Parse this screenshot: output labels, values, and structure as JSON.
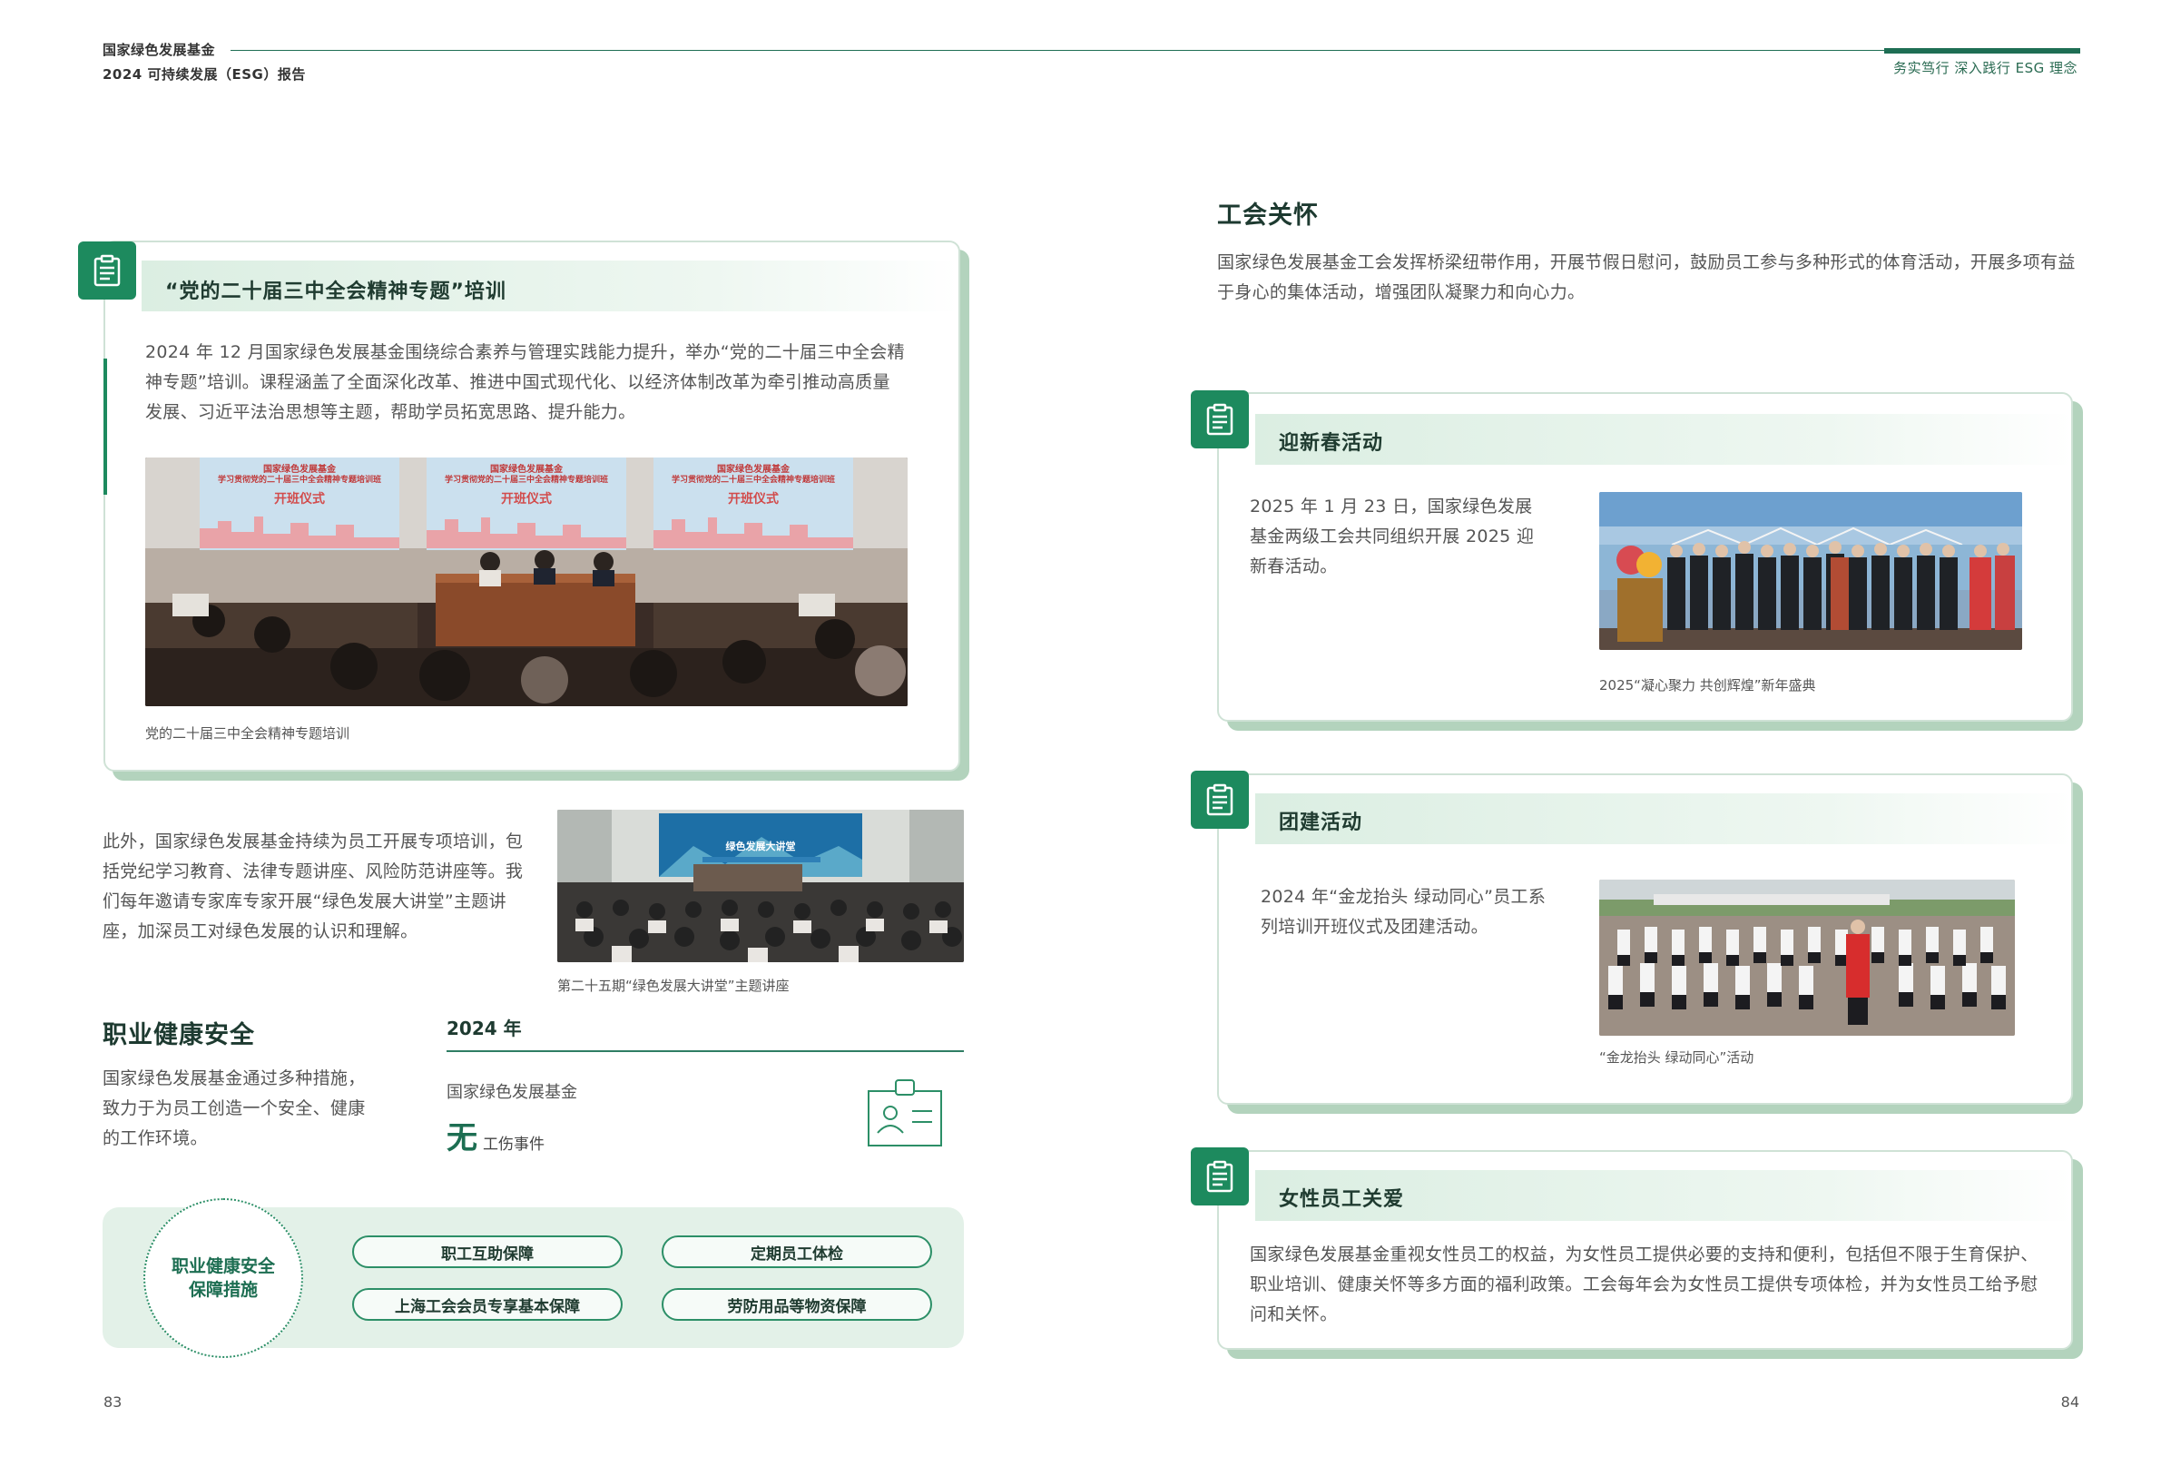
{
  "header": {
    "org": "国家绿色发展基金",
    "report": "2024 可持续发展（ESG）报告",
    "slogan": "务实笃行 深入践行 ESG 理念"
  },
  "pages": {
    "left": "83",
    "right": "84"
  },
  "training_card": {
    "title": "“党的二十届三中全会精神专题”培训",
    "body": "2024 年 12 月国家绿色发展基金围绕综合素养与管理实践能力提升，举办“党的二十届三中全会精神专题”培训。课程涵盖了全面深化改革、推进中国式现代化、以经济体制改革为牵引推动高质量发展、习近平法治思想等主题，帮助学员拓宽思路、提升能力。",
    "banner_org": "国家绿色发展基金",
    "banner_title": "学习贯彻党的二十届三中全会精神专题培训班",
    "banner_sub": "开班仪式",
    "caption": "党的二十届三中全会精神专题培训"
  },
  "special_training": {
    "body": "此外，国家绿色发展基金持续为员工开展专项培训，包括党纪学习教育、法律专题讲座、风险防范讲座等。我们每年邀请专家库专家开展“绿色发展大讲堂”主题讲座，加深员工对绿色发展的认识和理解。",
    "screen_title": "绿色发展大讲堂",
    "caption": "第二十五期“绿色发展大讲堂”主题讲座"
  },
  "ohs": {
    "title": "职业健康安全",
    "body": "国家绿色发展基金通过多种措施，致力于为员工创造一个安全、健康的工作环境。",
    "year_label": "2024 年",
    "stat_org": "国家绿色发展基金",
    "stat_value": "无",
    "stat_unit": "工伤事件"
  },
  "measures": {
    "circle_label": "职业健康安全保障措施",
    "items": [
      "职工互助保障",
      "定期员工体检",
      "上海工会会员专享基本保障",
      "劳防用品等物资保障"
    ]
  },
  "union": {
    "title": "工会关怀",
    "body": "国家绿色发展基金工会发挥桥梁纽带作用，开展节假日慰问，鼓励员工参与多种形式的体育活动，开展多项有益于身心的集体活动，增强团队凝聚力和向心力。"
  },
  "spring_card": {
    "title": "迎新春活动",
    "body": "2025 年 1 月 23 日，国家绿色发展基金两级工会共同组织开展 2025 迎新春活动。",
    "caption": "2025“凝心聚力 共创辉煌”新年盛典"
  },
  "team_card": {
    "title": "团建活动",
    "body": "2024 年“金龙抬头 绿动同心”员工系列培训开班仪式及团建活动。",
    "caption": "“金龙抬头 绿动同心”活动"
  },
  "women_card": {
    "title": "女性员工关爱",
    "body": "国家绿色发展基金重视女性员工的权益，为女性员工提供必要的支持和便利，包括但不限于生育保护、职业培训、健康关怀等多方面的福利政策。工会每年会为女性员工提供专项体检，并为女性员工给予慰问和关怀。"
  },
  "icons": [
    "clipboard-icon",
    "employee-id-card-icon"
  ],
  "colors": {
    "accent": "#1d8a5e",
    "dark_green": "#1e6e54",
    "card_border": "#cfe2d6",
    "card_shadow": "#b3d3bd"
  }
}
